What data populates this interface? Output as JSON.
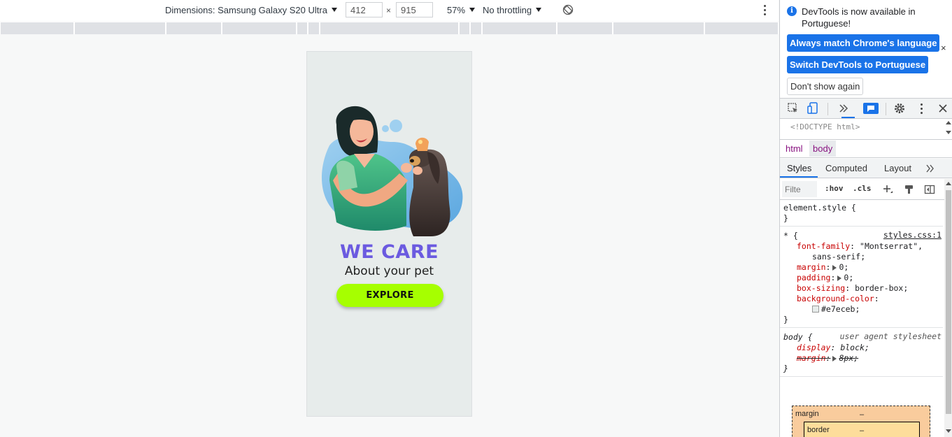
{
  "device_toolbar": {
    "dimensions_label": "Dimensions: Samsung Galaxy S20 Ultra",
    "width_value": "412",
    "height_value": "915",
    "times": "×",
    "zoom": "57%",
    "throttling": "No throttling"
  },
  "page": {
    "headline": "WE CARE",
    "subline": "About your pet",
    "cta": "EXPLORE",
    "colors": {
      "background": "#e7eceb",
      "headline": "#6b5ae0",
      "cta": "#a6ff00"
    }
  },
  "devtools": {
    "infobar": {
      "message": "DevTools is now available in Portuguese!",
      "always_match": "Always match Chrome's language",
      "switch": "Switch DevTools to Portuguese",
      "dont_show": "Don't show again",
      "close": "×"
    },
    "code_preview": "<!DOCTYPE html>",
    "breadcrumbs": [
      "html",
      "body"
    ],
    "subtabs": [
      "Styles",
      "Computed",
      "Layout"
    ],
    "filter_placeholder": "Filte",
    "hov": ":hov",
    "cls": ".cls",
    "styles": {
      "element_style": "element.style {",
      "close_brace": "}",
      "universal_selector": "* {",
      "universal_source": "styles.css:1",
      "universal_props": [
        {
          "name": "font-family",
          "value": "\"Montserrat\","
        },
        {
          "name": "",
          "value": "sans-serif;"
        },
        {
          "name": "margin",
          "value": "0;"
        },
        {
          "name": "padding",
          "value": "0;"
        },
        {
          "name": "box-sizing",
          "value": "border-box;"
        },
        {
          "name": "background-color",
          "value": ""
        },
        {
          "name": "",
          "value": "#e7eceb;"
        }
      ],
      "body_selector": "body {",
      "body_source": "user agent stylesheet",
      "body_props": [
        {
          "name": "display",
          "value": "block;"
        },
        {
          "name": "margin",
          "value": "8px;"
        }
      ]
    },
    "boxmodel": {
      "margin": "margin",
      "margin_value": "–",
      "border": "border",
      "border_value": "–"
    }
  }
}
